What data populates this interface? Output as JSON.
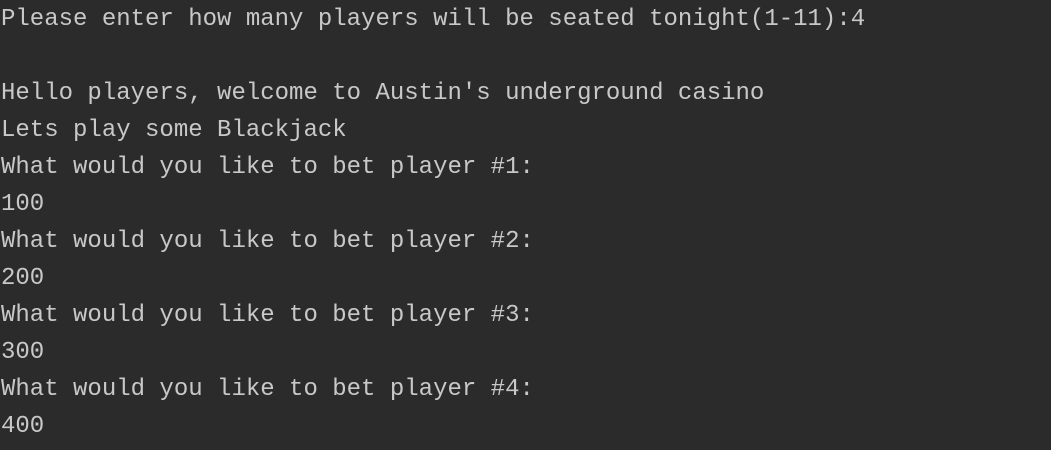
{
  "console": {
    "prompt_players": "Please enter how many players will be seated tonight(1-11):",
    "input_players": "4",
    "welcome": "Hello players, welcome to Austin's underground casino",
    "game": "Lets play some Blackjack",
    "bets": [
      {
        "prompt": "What would you like to bet player #1:",
        "input": "100"
      },
      {
        "prompt": "What would you like to bet player #2:",
        "input": "200"
      },
      {
        "prompt": "What would you like to bet player #3:",
        "input": "300"
      },
      {
        "prompt": "What would you like to bet player #4:",
        "input": "400"
      }
    ]
  }
}
